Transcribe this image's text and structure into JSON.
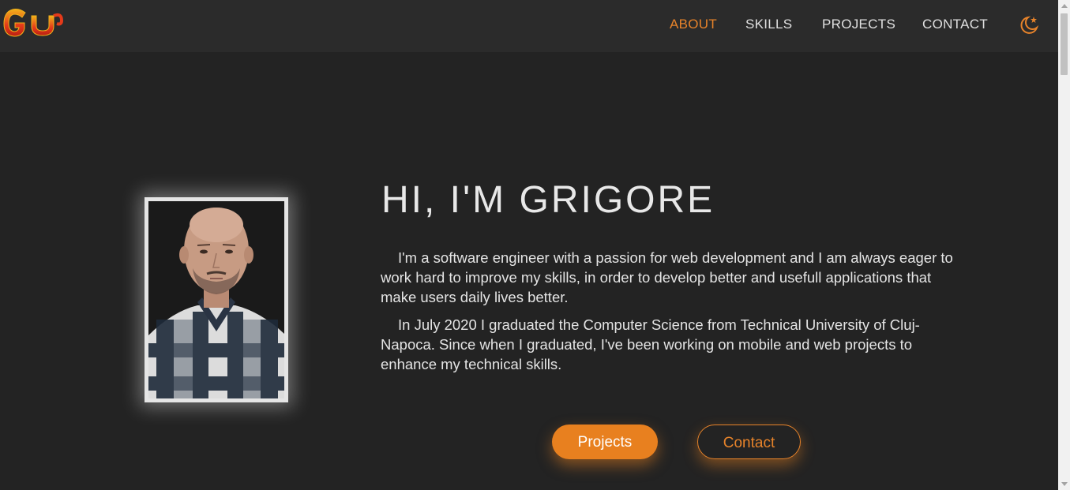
{
  "logo": {
    "text": "GU",
    "colors": [
      "#e53a1a",
      "#f2b21a"
    ]
  },
  "nav": {
    "items": [
      {
        "label": "ABOUT",
        "active": true
      },
      {
        "label": "SKILLS",
        "active": false
      },
      {
        "label": "PROJECTS",
        "active": false
      },
      {
        "label": "CONTACT",
        "active": false
      }
    ],
    "theme_toggle_icon": "moon-star-icon"
  },
  "hero": {
    "title": "HI, I'M GRIGORE",
    "paragraphs": [
      "I'm a software engineer with a passion for web development and I am always eager to work hard to improve my skills, in order to develop better and usefull applications that make users daily lives better.",
      "In July 2020 I graduated the Computer Science from Technical University of Cluj-Napoca. Since when I graduated, I've been working on mobile and web projects to enhance my technical skills."
    ],
    "buttons": {
      "projects": "Projects",
      "contact": "Contact"
    }
  },
  "colors": {
    "accent": "#e7832a",
    "background": "#232323",
    "navbar": "#2b2b2b",
    "text": "#e6e6e6"
  }
}
